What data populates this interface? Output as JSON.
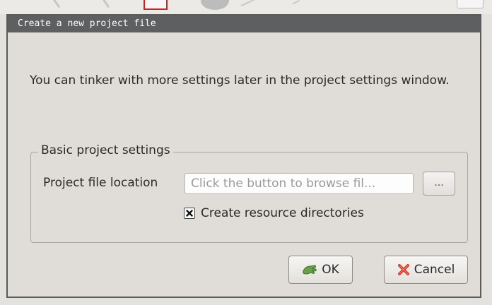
{
  "dialog": {
    "title": "Create a new project file",
    "intro_text": "You can tinker with more settings later in the project settings window.",
    "group": {
      "title": "Basic project settings",
      "location_label": "Project file location",
      "location_value": "",
      "location_placeholder": "Click the button to browse fil...",
      "browse_label": "...",
      "checkbox_label": "Create resource directories",
      "checkbox_checked": true
    },
    "buttons": {
      "ok_label": "OK",
      "cancel_label": "Cancel"
    }
  },
  "icons": {
    "ok": "ok-hand-icon",
    "cancel": "cancel-x-icon",
    "checkbox": "checkbox-x-mark"
  },
  "colors": {
    "titlebar_bg": "#5d5f61",
    "dialog_bg": "#e0ddd9",
    "ok_icon": "#6aa04a",
    "cancel_icon": "#d13a2a"
  }
}
